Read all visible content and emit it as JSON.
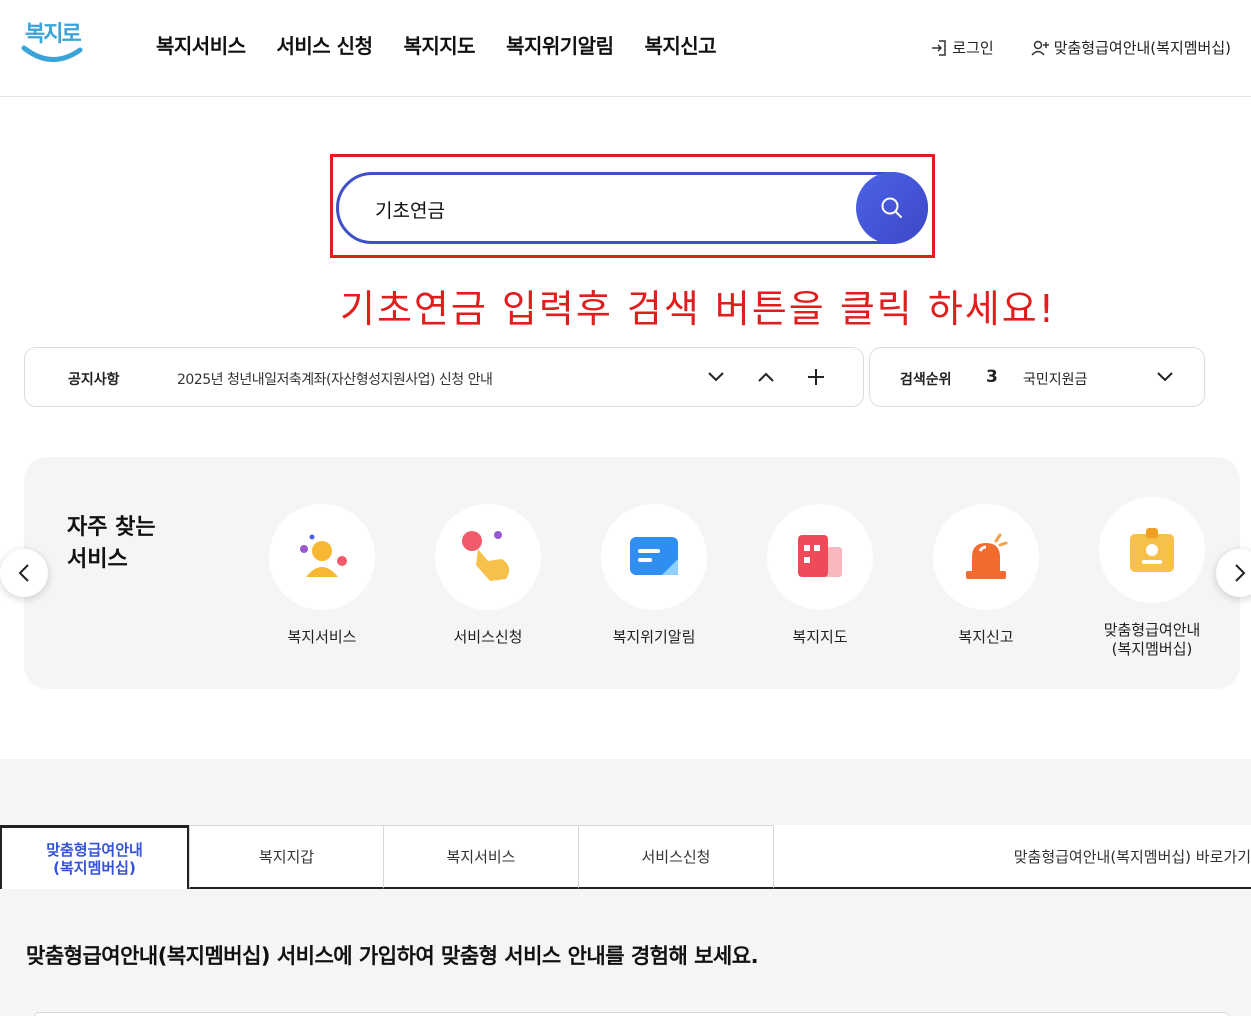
{
  "header": {
    "logo_text": "복지로",
    "nav": [
      "복지서비스",
      "서비스 신청",
      "복지지도",
      "복지위기알림",
      "복지신고"
    ],
    "login_label": "로그인",
    "membership_label": "맞춤형급여안내(복지멤버십)"
  },
  "search": {
    "value": "기초연금",
    "instruction": "기초연금 입력후 검색 버튼을 클릭 하세요!"
  },
  "notice": {
    "label": "공지사항",
    "text": "2025년 청년내일저축계좌(자산형성지원사업) 신청 안내"
  },
  "ranking": {
    "label": "검색순위",
    "rank": "3",
    "term": "국민지원금"
  },
  "frequent": {
    "title_line1": "자주 찾는",
    "title_line2": "서비스",
    "items": [
      {
        "label": "복지서비스",
        "icon": "people-icon"
      },
      {
        "label": "서비스신청",
        "icon": "hand-tap-icon"
      },
      {
        "label": "복지위기알림",
        "icon": "message-icon"
      },
      {
        "label": "복지지도",
        "icon": "building-icon"
      },
      {
        "label": "복지신고",
        "icon": "siren-icon"
      },
      {
        "label_line1": "맞춤형급여안내",
        "label_line2": "(복지멤버십)",
        "icon": "id-badge-icon"
      }
    ]
  },
  "tabs": {
    "active_line1": "맞춤형급여안내",
    "active_line2": "(복지멤버십)",
    "items": [
      "복지지갑",
      "복지서비스",
      "서비스신청"
    ],
    "shortcut": "맞춤형급여안내(복지멤버십) 바로가기"
  },
  "lower": {
    "headline": "맞춤형급여안내(복지멤버십) 서비스에 가입하여 맞춤형 서비스 안내를 경험해 보세요."
  },
  "colors": {
    "accent_blue": "#3f4fc9",
    "highlight_red": "#e01e1e",
    "panel_gray": "#f4f5f6"
  }
}
